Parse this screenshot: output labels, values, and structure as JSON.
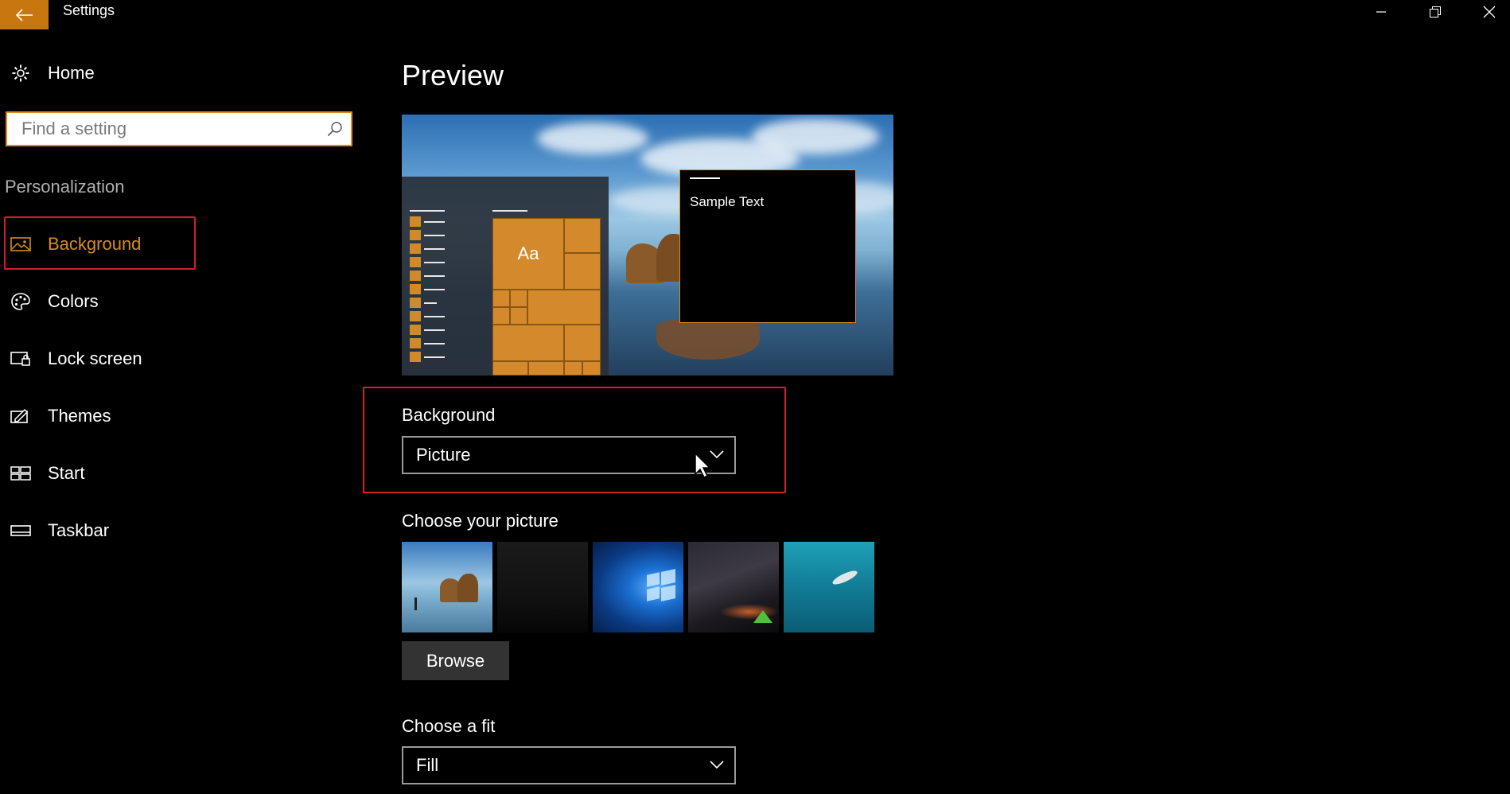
{
  "window": {
    "title": "Settings"
  },
  "sidebar": {
    "home_label": "Home",
    "search_placeholder": "Find a setting",
    "section_header": "Personalization",
    "items": [
      {
        "label": "Background",
        "icon": "picture-icon",
        "selected": true
      },
      {
        "label": "Colors",
        "icon": "palette-icon"
      },
      {
        "label": "Lock screen",
        "icon": "lock-screen-icon"
      },
      {
        "label": "Themes",
        "icon": "themes-icon"
      },
      {
        "label": "Start",
        "icon": "start-icon"
      },
      {
        "label": "Taskbar",
        "icon": "taskbar-icon"
      }
    ]
  },
  "main": {
    "preview_title": "Preview",
    "preview_tile_text": "Aa",
    "preview_sample_text": "Sample Text",
    "background_label": "Background",
    "background_value": "Picture",
    "choose_picture_label": "Choose your picture",
    "browse_label": "Browse",
    "choose_fit_label": "Choose a fit",
    "fit_value": "Fill"
  },
  "colors": {
    "accent": "#d98c1c",
    "highlight_box": "#d0202a",
    "background": "#000000"
  }
}
